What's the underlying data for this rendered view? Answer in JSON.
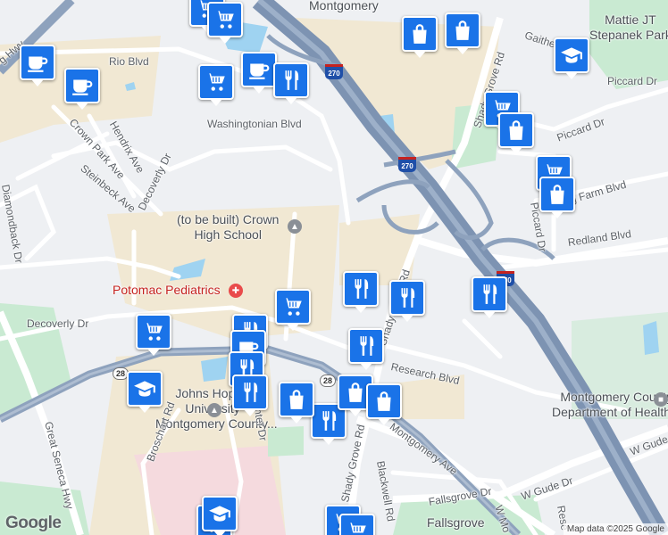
{
  "labels": {
    "montgomery": "Montgomery",
    "mattie": "Mattie JT\nStepanek Park",
    "rio_blvd": "Rio Blvd",
    "hwy_nw": "g Hwy",
    "hendrix": "Hendrix Ave",
    "crown_park": "Crown Park Ave",
    "steinbeck": "Steinbeck Ave",
    "diamondback": "Diamondback Dr",
    "decoverly_top": "Decoverly Dr",
    "decoverly_left": "Decoverly Dr",
    "washingtonian": "Washingtonian Blvd",
    "crown_high": "(to be built) Crown\nHigh School",
    "potomac": "Potomac Pediatrics",
    "research": "Research Blvd",
    "jhu": "Johns Hopkins\nUniversity -\nMontgomery County...",
    "montgomery_ave": "Montgomery Ave",
    "shady_grove_top": "Shady Grove Rd",
    "shady_grove_mid": "Shady Grove Rd",
    "shady_grove_bottom": "Shady Grove Rd",
    "gaither": "Gaither",
    "piccard_top": "Piccard Dr",
    "piccard_mid": "Piccard Dr",
    "piccard_vert": "Piccard Dr",
    "king_farm": "King Farm Blvd",
    "redland": "Redland Blvd",
    "health": "Montgomery County\nDepartment of Health...",
    "w_gude": "W Gude Dr",
    "w_gude_right": "W Gude",
    "blackwell": "Blackwell Rd",
    "fallsgrove_dr": "Fallsgrove Dr",
    "fallsgrove": "Fallsgrove",
    "great_seneca": "Great Seneca Hwy",
    "broschart": "Broschart Rd",
    "center_dr": "Center Dr",
    "reserve": "Rese",
    "mo": "W Mo",
    "bla_dr": "a Dr",
    "sha_rd": "Shady Rd"
  },
  "shields": {
    "md28_a": "28",
    "md28_b": "28",
    "i270_a": "270",
    "i270_b": "270",
    "i270_c": "270"
  },
  "pins": [
    {
      "icon": "cart-icon"
    },
    {
      "icon": "cart-icon"
    },
    {
      "icon": "coffee-icon"
    },
    {
      "icon": "coffee-icon"
    },
    {
      "icon": "cart-icon"
    },
    {
      "icon": "coffee-icon"
    },
    {
      "icon": "restaurant-icon"
    },
    {
      "icon": "shopping-bag-icon"
    },
    {
      "icon": "shopping-bag-icon"
    },
    {
      "icon": "graduation-cap-icon"
    },
    {
      "icon": "cart-icon"
    },
    {
      "icon": "shopping-bag-icon"
    },
    {
      "icon": "cart-icon"
    },
    {
      "icon": "shopping-bag-icon"
    },
    {
      "icon": "restaurant-icon"
    },
    {
      "icon": "restaurant-icon"
    },
    {
      "icon": "restaurant-icon"
    },
    {
      "icon": "cart-icon"
    },
    {
      "icon": "restaurant-icon"
    },
    {
      "icon": "cart-icon"
    },
    {
      "icon": "coffee-icon"
    },
    {
      "icon": "restaurant-icon"
    },
    {
      "icon": "restaurant-icon"
    },
    {
      "icon": "restaurant-icon"
    },
    {
      "icon": "graduation-cap-icon"
    },
    {
      "icon": "restaurant-icon"
    },
    {
      "icon": "shopping-bag-icon"
    },
    {
      "icon": "shopping-bag-icon"
    },
    {
      "icon": "shopping-bag-icon"
    },
    {
      "icon": "restaurant-icon"
    },
    {
      "icon": "graduation-cap-icon"
    },
    {
      "icon": "cart-icon"
    },
    {
      "icon": "cart-icon"
    }
  ],
  "logo": "Google",
  "attribution": "Map data ©2025 Google",
  "colors": {
    "pin": "#1a73e8",
    "highway": "#8ea2bd",
    "water": "#9fd3f1",
    "park": "#c9ead2",
    "urban": "#f1e8d3"
  }
}
